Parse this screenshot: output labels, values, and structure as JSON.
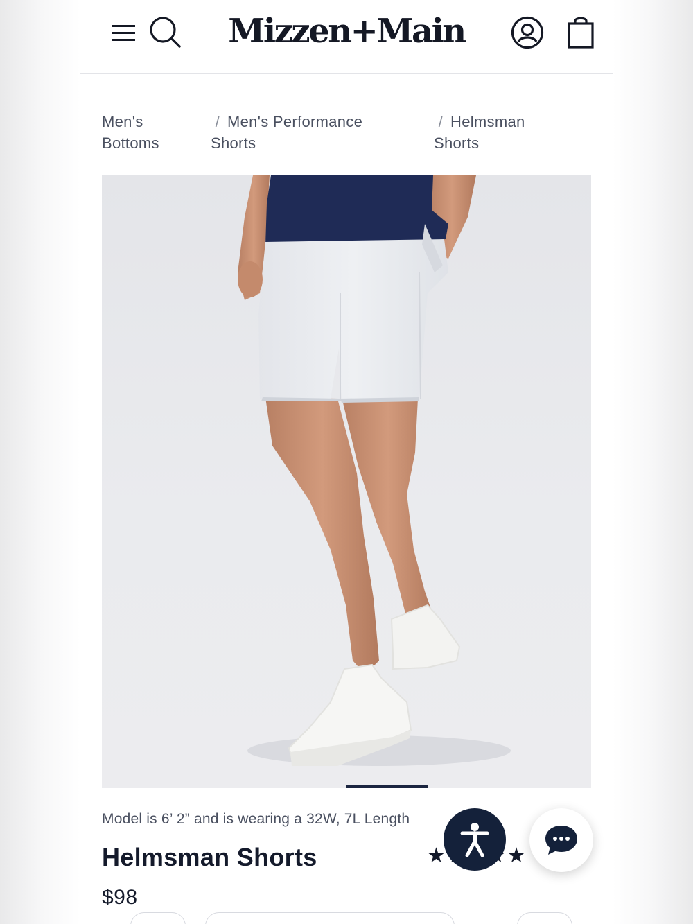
{
  "header": {
    "logo": "Mizzen+Main",
    "icons": {
      "menu": "hamburger-menu-icon",
      "search": "search-icon",
      "account": "account-icon",
      "cart": "shopping-bag-icon"
    }
  },
  "breadcrumb": {
    "separator": "/",
    "items": [
      {
        "label": "Men's Bottoms"
      },
      {
        "label": "Men's Performance Shorts"
      },
      {
        "label": "Helmsman Shorts"
      }
    ]
  },
  "product": {
    "model_note": "Model is 6’ 2” and is wearing a 32W, 7L Length",
    "title": "Helmsman Shorts",
    "price": "$98",
    "rating": 5,
    "rating_max": 5
  },
  "widgets": {
    "accessibility_icon": "accessibility-icon",
    "chat_icon": "chat-bubble-icon"
  },
  "colors": {
    "brand_navy": "#14213a",
    "text": "#141a2b",
    "muted_text": "#4a5060"
  }
}
